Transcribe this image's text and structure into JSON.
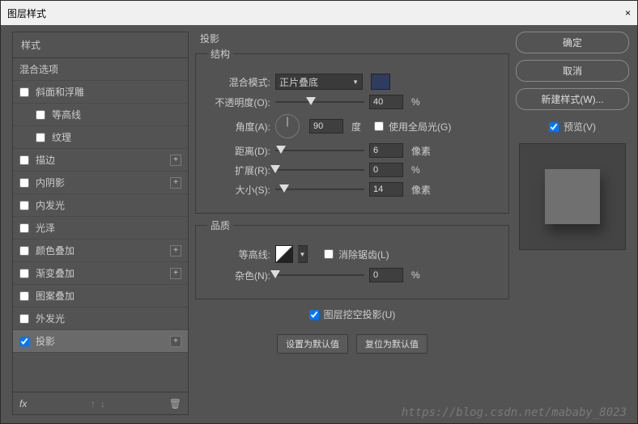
{
  "title": "图层样式",
  "left": {
    "header": "样式",
    "blend": "混合选项",
    "items": [
      {
        "label": "斜面和浮雕",
        "checked": false,
        "plus": false,
        "sub": false
      },
      {
        "label": "等高线",
        "checked": false,
        "plus": false,
        "sub": true
      },
      {
        "label": "纹理",
        "checked": false,
        "plus": false,
        "sub": true
      },
      {
        "label": "描边",
        "checked": false,
        "plus": true,
        "sub": false
      },
      {
        "label": "内阴影",
        "checked": false,
        "plus": true,
        "sub": false
      },
      {
        "label": "内发光",
        "checked": false,
        "plus": false,
        "sub": false
      },
      {
        "label": "光泽",
        "checked": false,
        "plus": false,
        "sub": false
      },
      {
        "label": "颜色叠加",
        "checked": false,
        "plus": true,
        "sub": false
      },
      {
        "label": "渐变叠加",
        "checked": false,
        "plus": true,
        "sub": false
      },
      {
        "label": "图案叠加",
        "checked": false,
        "plus": false,
        "sub": false
      },
      {
        "label": "外发光",
        "checked": false,
        "plus": false,
        "sub": false
      },
      {
        "label": "投影",
        "checked": true,
        "plus": true,
        "sub": false,
        "selected": true
      }
    ],
    "fx": "fx"
  },
  "mid": {
    "section": "投影",
    "structure": {
      "legend": "结构",
      "blend_mode_label": "混合模式:",
      "blend_mode_value": "正片叠底",
      "opacity_label": "不透明度(O):",
      "opacity_value": "40",
      "opacity_unit": "%",
      "angle_label": "角度(A):",
      "angle_value": "90",
      "angle_unit": "度",
      "global_light": "使用全局光(G)",
      "distance_label": "距离(D):",
      "distance_value": "6",
      "distance_unit": "像素",
      "spread_label": "扩展(R):",
      "spread_value": "0",
      "spread_unit": "%",
      "size_label": "大小(S):",
      "size_value": "14",
      "size_unit": "像素"
    },
    "quality": {
      "legend": "品质",
      "contour_label": "等高线:",
      "antialias": "消除锯齿(L)",
      "noise_label": "杂色(N):",
      "noise_value": "0",
      "noise_unit": "%"
    },
    "knockout": "图层挖空投影(U)",
    "make_default": "设置为默认值",
    "reset_default": "复位为默认值"
  },
  "right": {
    "ok": "确定",
    "cancel": "取消",
    "new_style": "新建样式(W)...",
    "preview": "预览(V)"
  },
  "watermark": "https://blog.csdn.net/mababy_8023"
}
